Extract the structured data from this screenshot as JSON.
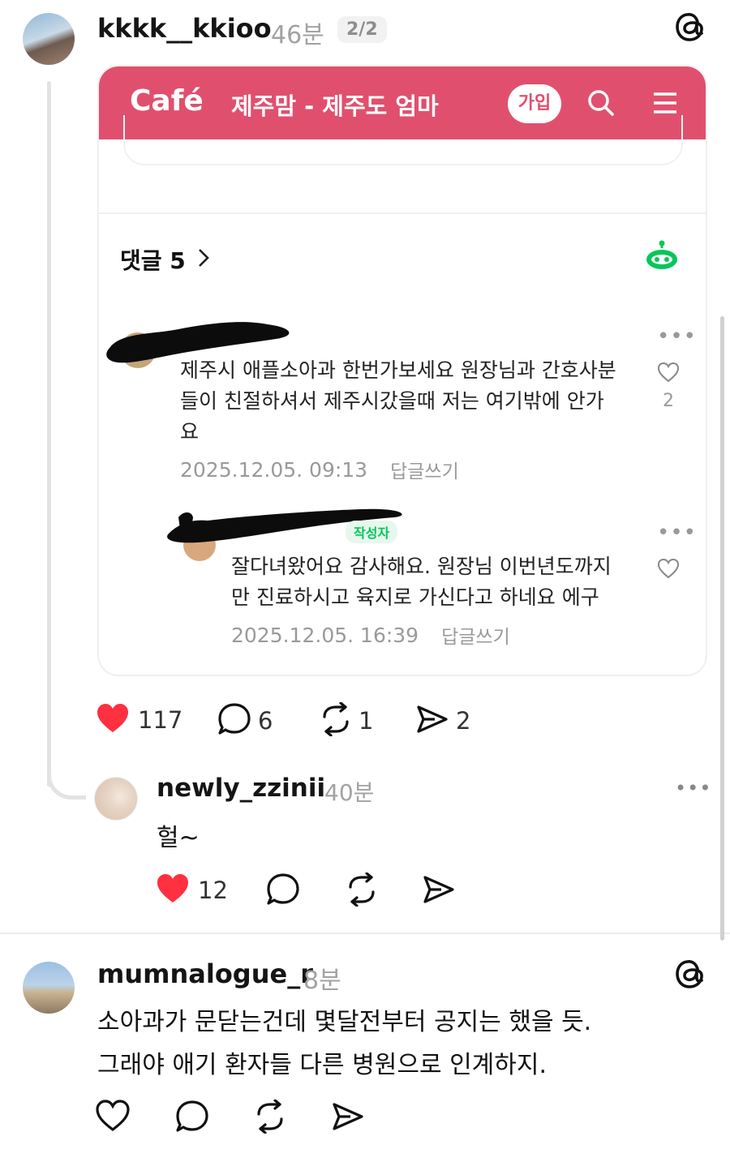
{
  "post1": {
    "username": "kkkk__kkioo",
    "time": "46분",
    "page_badge": "2/2",
    "embed": {
      "brand": "Café",
      "cafe_name": "제주맘 - 제주도 엄마",
      "join_label": "가입",
      "comments_header": "댓글 5",
      "comment": {
        "text": "제주시 애플소아과 한번가보세요 원장님과 간호사분들이 친절하셔서 제주시갔을때 저는 여기밖에 안가요",
        "line1": "제주시 애플소아과 한번가보세요 원장님과 간호사분",
        "line2": "들이 친절하셔서 제주시갔을때 저는 여기밖에 안가",
        "line3": "요",
        "date": "2025.12.05. 09:13",
        "reply_label": "답글쓰기",
        "like_count": "2"
      },
      "reply": {
        "badge": "작성자",
        "line1": "잘다녀왔어요 감사해요. 원장님 이번년도까지",
        "line2": "만 진료하시고 육지로 가신다고 하네요 에구",
        "date": "2025.12.05. 16:39",
        "reply_label": "답글쓰기"
      }
    },
    "actions": {
      "likes": "117",
      "comments": "6",
      "reposts": "1",
      "shares": "2"
    }
  },
  "reply1": {
    "username": "newly_zzinii",
    "time": "40분",
    "text": "헐~",
    "likes": "12"
  },
  "post2": {
    "username": "mumnalogue_r",
    "time": "8분",
    "line1": "소아과가 문닫는건데 몇달전부터 공지는 했을 듯.",
    "line2": "그래야 애기 환자들 다른 병원으로 인계하지."
  },
  "colors": {
    "cafe_pink": "#e0506e",
    "like_red": "#ff3040",
    "naver_green": "#03c75a"
  }
}
